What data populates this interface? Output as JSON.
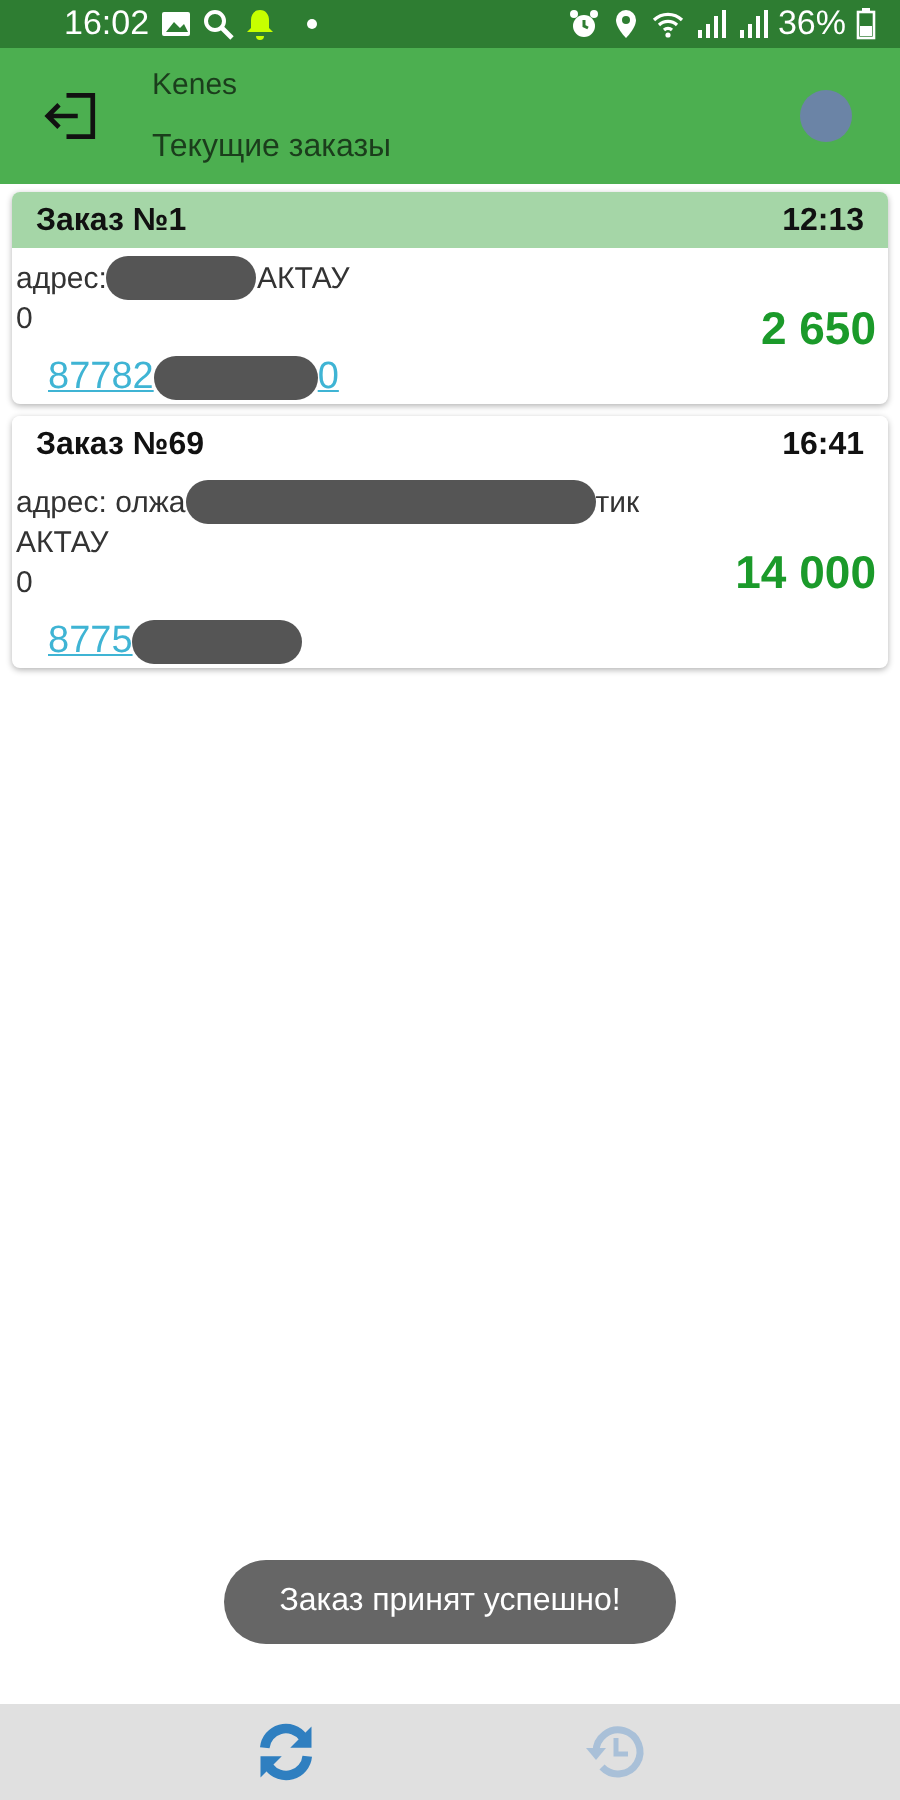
{
  "status_bar": {
    "time": "16:02",
    "battery": "36%"
  },
  "app_bar": {
    "title": "Kenes",
    "subtitle": "Текущие заказы"
  },
  "orders": [
    {
      "title": "Заказ №1",
      "time": "12:13",
      "highlighted": true,
      "address_start": "адрес:",
      "address_end": "АКТАУ",
      "note": "0",
      "amount": "2 650",
      "phone_start": "87782",
      "phone_end": "0"
    },
    {
      "title": "Заказ №69",
      "time": "16:41",
      "highlighted": false,
      "address_start": "адрес: олжа",
      "address_end": "тик",
      "address_line_2": "АКТАУ",
      "note": "0",
      "amount": "14 000",
      "phone_start": "8775"
    }
  ],
  "toast": "Заказ принят успешно!",
  "bottom_nav": [
    {
      "kind": "refresh",
      "selected": true
    },
    {
      "kind": "history",
      "selected": false
    }
  ]
}
